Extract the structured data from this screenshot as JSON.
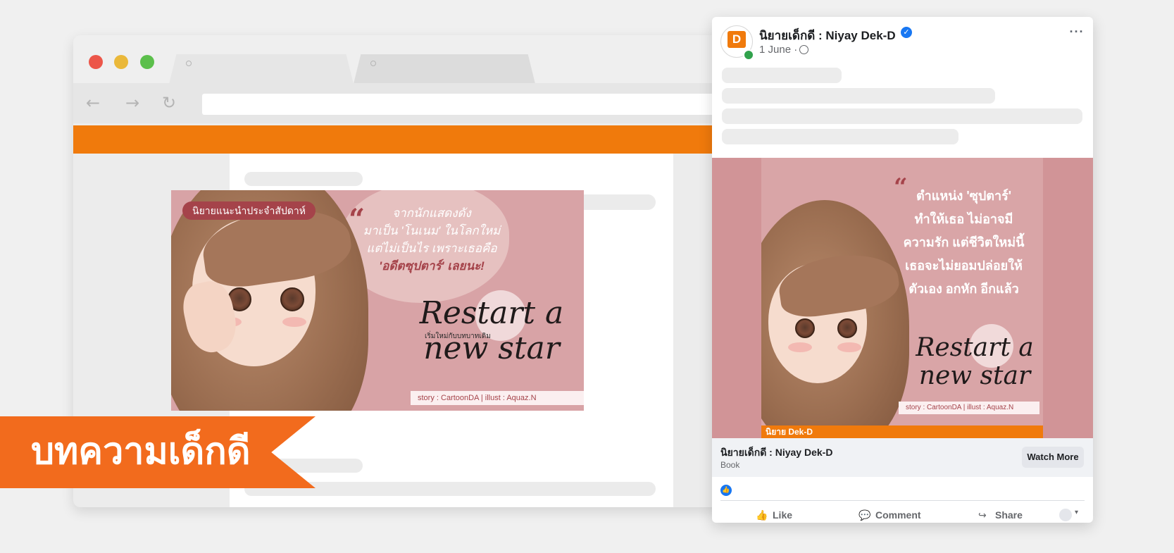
{
  "browser": {
    "nav": {
      "back_icon": "arrow-left-icon",
      "forward_icon": "arrow-right-icon",
      "reload_icon": "reload-icon"
    },
    "accent_color": "#f07a0c"
  },
  "banner": {
    "badge": "นิยายแนะนำประจำสัปดาห์",
    "quote_lines": [
      "จากนักแสดงดัง",
      "มาเป็น 'โนเนม' ในโลกใหม่",
      "แต่ไม่เป็นไร เพราะเธอคือ",
      "'อดีตซุปตาร์' เลยนะ!"
    ],
    "title_line1": "Restart a",
    "title_sub": "เริ่มใหม่กับบทบาทเดิม",
    "title_line2": "new star",
    "credit": "story : CartoonDA   |   illust : Aquaz.N"
  },
  "ribbon": {
    "label": "บทความเด็กดี",
    "color": "#f26b1d"
  },
  "post": {
    "page_name": "นิยายเด็กดี : Niyay Dek-D",
    "verified_icon": "verified-check-icon",
    "date": "1 June ·",
    "privacy_icon": "globe-icon",
    "more_icon": "more-horizontal-icon",
    "image": {
      "quote_lines": [
        "ตำแหน่ง 'ซุปตาร์'",
        "ทำให้เธอ ไม่อาจมี",
        "ความรัก แต่ชีวิตใหม่นี้",
        "เธอจะไม่ยอมปล่อยให้",
        "ตัวเอง อกหัก อีกแล้ว"
      ],
      "title_line1": "Restart a",
      "title_line2": "new star",
      "credit": "story : CartoonDA   |   illust : Aquaz.N",
      "brand_strip": "นิยาย Dek-D"
    },
    "link": {
      "name": "นิยายเด็กดี : Niyay Dek-D",
      "category": "Book",
      "button": "Watch More"
    },
    "actions": {
      "like": "Like",
      "comment": "Comment",
      "share": "Share"
    }
  }
}
